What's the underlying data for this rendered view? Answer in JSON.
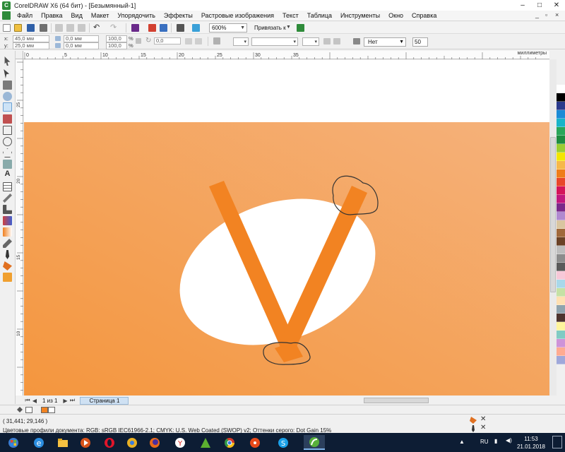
{
  "window": {
    "title": "CorelDRAW X6 (64 бит) - [Безымянный-1]",
    "controls": [
      "–",
      "□",
      "✕"
    ],
    "doc_controls": [
      "_",
      "▫",
      "×"
    ]
  },
  "menu": {
    "items": [
      "Файл",
      "Правка",
      "Вид",
      "Макет",
      "Упорядочить",
      "Эффекты",
      "Растровые изображения",
      "Текст",
      "Таблица",
      "Инструменты",
      "Окно",
      "Справка"
    ]
  },
  "toolbar": {
    "zoom": "600%",
    "snap_label": "Привязать к"
  },
  "propbar": {
    "x_label": "x:",
    "x_value": "45,0 мм",
    "y_label": "y:",
    "y_value": "25,0 мм",
    "w_value": "0,0 мм",
    "h_value": "0,0 мм",
    "scale_w": "100,0",
    "scale_h": "100,0",
    "pct": "%",
    "rotate_value": "0,0",
    "outline_label": "Нет",
    "outline_width": "50"
  },
  "ruler": {
    "units": "миллиметры",
    "h_ticks": [
      "0",
      "5",
      "10",
      "15",
      "20",
      "25",
      "30",
      "35"
    ],
    "v_ticks": [
      "25",
      "20",
      "15",
      "10"
    ]
  },
  "pagenav": {
    "first": "⏮",
    "prev": "◀",
    "count": "1 из 1",
    "next": "▶",
    "last": "⏭",
    "tab": "Страница 1"
  },
  "status": {
    "coords": "( 31,441; 29,146 )",
    "profiles": "Цветовые профили документа: RGB: sRGB IEC61966-2.1; CMYK: U.S. Web Coated (SWOP) v2; Оттенки серого: Dot Gain 15%"
  },
  "taskbar": {
    "lang": "RU",
    "time": "11:53",
    "date": "21.01.2018"
  },
  "colors": {
    "orange_bg": "#f39a45",
    "orange_stroke": "#f28322",
    "palette": [
      "#ffffff",
      "#000000",
      "#2a3a8c",
      "#1b8bd6",
      "#19b4c9",
      "#2aa65a",
      "#1e8c40",
      "#9acd32",
      "#f3e600",
      "#f6b84a",
      "#ef7d1a",
      "#e8462a",
      "#d4145a",
      "#c0197e",
      "#7a2a8a",
      "#b08ad0",
      "#d9c5a0",
      "#a0683a",
      "#6b4226",
      "#bdbdbd",
      "#8c8c8c",
      "#5a5a5a",
      "#f7c8d8",
      "#a8d8ea",
      "#c5e1a5",
      "#ffe0b2",
      "#90a4ae",
      "#4e342e",
      "#fff59d",
      "#80cbc4",
      "#ce93d8",
      "#ffab91",
      "#9fa8da"
    ]
  },
  "icons": {
    "tools": [
      "pick-tool-icon",
      "shape-tool-icon",
      "crop-tool-icon",
      "zoom-tool-icon",
      "freehand-tool-icon",
      "artistic-media-icon",
      "rectangle-tool-icon",
      "ellipse-tool-icon",
      "polygon-tool-icon",
      "basic-shapes-icon",
      "text-tool-icon",
      "table-tool-icon",
      "parallel-dimension-icon",
      "connector-icon",
      "blend-icon",
      "transparency-icon",
      "eyedropper-icon",
      "outline-pen-icon",
      "fill-icon",
      "smart-fill-icon"
    ]
  }
}
